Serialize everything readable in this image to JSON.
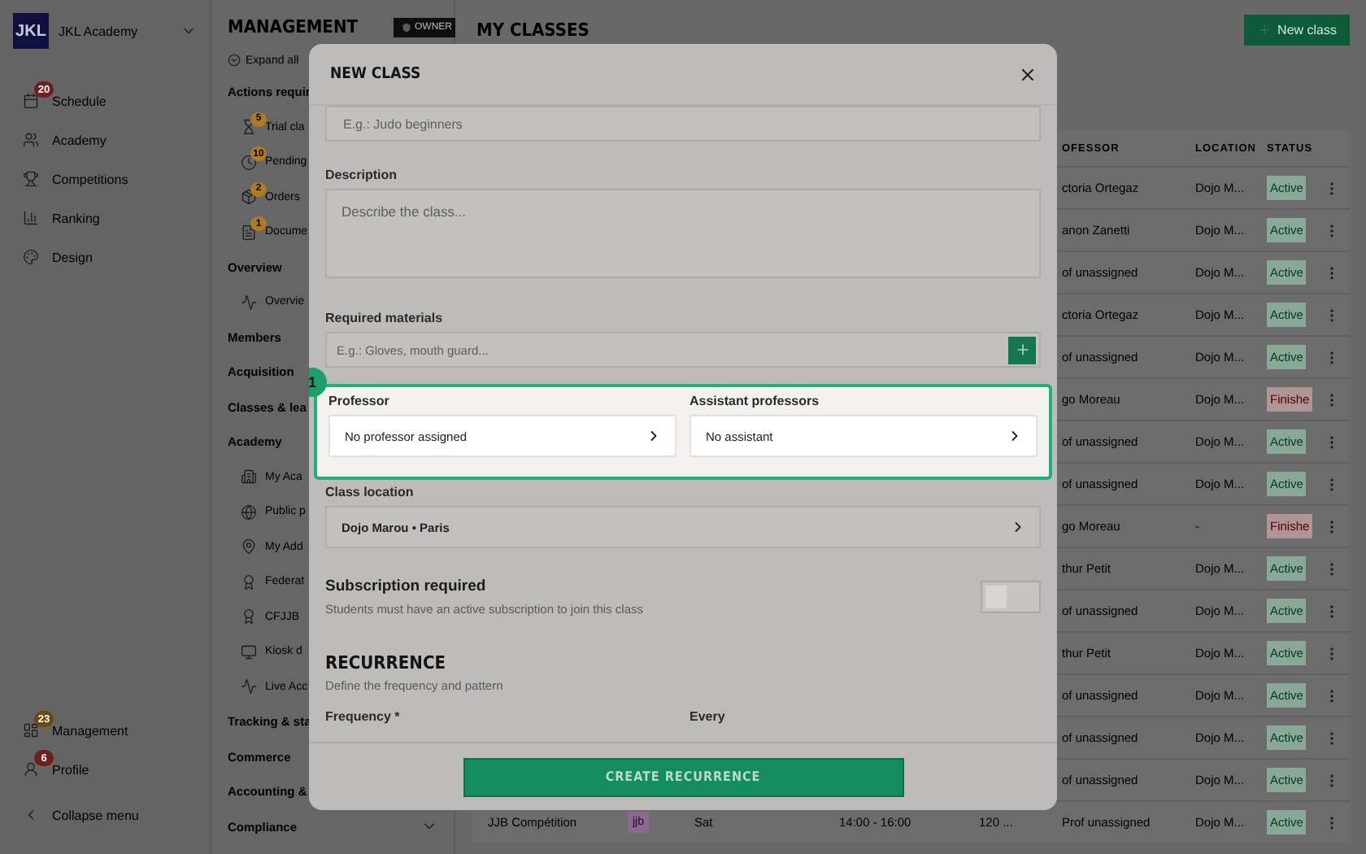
{
  "app": {
    "logo": "JKL",
    "name": "JKL Academy"
  },
  "nav": [
    {
      "label": "Schedule",
      "badge": "20",
      "color": "#6b1f1f"
    },
    {
      "label": "Academy"
    },
    {
      "label": "Competitions"
    },
    {
      "label": "Ranking"
    },
    {
      "label": "Design"
    }
  ],
  "nav_bottom": [
    {
      "label": "Management",
      "badge": "23",
      "color": "#6a4a12"
    },
    {
      "label": "Profile",
      "badge": "6",
      "color": "#6b1f1f"
    }
  ],
  "collapse": "Collapse menu",
  "management": {
    "title": "MANAGEMENT",
    "role": "OWNER",
    "expand": "Expand all",
    "sections": [
      {
        "label": "Actions requir",
        "children": [
          {
            "label": "Trial cla",
            "badge": "5"
          },
          {
            "label": "Pending",
            "badge": "10"
          },
          {
            "label": "Orders",
            "badge": "2"
          },
          {
            "label": "Docume",
            "badge": "1"
          }
        ]
      },
      {
        "label": "Overview",
        "children": [
          {
            "label": "Overvie"
          }
        ]
      },
      {
        "label": "Members"
      },
      {
        "label": "Acquisition"
      },
      {
        "label": "Classes & lea"
      },
      {
        "label": "Academy",
        "children": [
          {
            "label": "My Aca"
          },
          {
            "label": "Public p"
          },
          {
            "label": "My Add"
          },
          {
            "label": "Federat"
          },
          {
            "label": "CFJJB"
          },
          {
            "label": "Kiosk d"
          },
          {
            "label": "Live Acc"
          }
        ]
      },
      {
        "label": "Tracking & sta"
      },
      {
        "label": "Commerce"
      },
      {
        "label": "Accounting &"
      },
      {
        "label": "Compliance",
        "collapsible": true
      }
    ]
  },
  "page": {
    "title": "MY CLASSES",
    "new_button": "New class"
  },
  "table": {
    "columns": [
      "OFESSOR",
      "LOCATION",
      "STATUS"
    ],
    "rows": [
      {
        "professor": "ctoria Ortegaz",
        "location": "Dojo M...",
        "status": "Active",
        "kind": "active"
      },
      {
        "professor": "anon Zanetti",
        "location": "Dojo M...",
        "status": "Active",
        "kind": "active"
      },
      {
        "professor": "of unassigned",
        "location": "Dojo M...",
        "status": "Active",
        "kind": "active"
      },
      {
        "professor": "ctoria Ortegaz",
        "location": "Dojo M...",
        "status": "Active",
        "kind": "active"
      },
      {
        "professor": "of unassigned",
        "location": "Dojo M...",
        "status": "Active",
        "kind": "active"
      },
      {
        "professor": "go Moreau",
        "location": "Dojo M...",
        "status": "Finishe",
        "kind": "finished"
      },
      {
        "professor": "of unassigned",
        "location": "Dojo M...",
        "status": "Active",
        "kind": "active"
      },
      {
        "professor": "of unassigned",
        "location": "Dojo M...",
        "status": "Active",
        "kind": "active"
      },
      {
        "professor": "go Moreau",
        "location": "-",
        "status": "Finishe",
        "kind": "finished"
      },
      {
        "professor": "thur Petit",
        "location": "Dojo M...",
        "status": "Active",
        "kind": "active"
      },
      {
        "professor": "of unassigned",
        "location": "Dojo M...",
        "status": "Active",
        "kind": "active"
      },
      {
        "professor": "thur Petit",
        "location": "Dojo M...",
        "status": "Active",
        "kind": "active"
      },
      {
        "professor": "of unassigned",
        "location": "Dojo M...",
        "status": "Active",
        "kind": "active"
      },
      {
        "professor": "of unassigned",
        "location": "Dojo M...",
        "status": "Active",
        "kind": "active"
      },
      {
        "professor": "of unassigned",
        "location": "Dojo M...",
        "status": "Active",
        "kind": "active"
      },
      {
        "name": "JJB Compétition",
        "tag": "jjb",
        "day": "Sat",
        "time": "14:00 - 16:00",
        "duration": "120 ...",
        "professor": "Prof unassigned",
        "location": "Dojo M...",
        "status": "Active",
        "kind": "active"
      }
    ]
  },
  "dialog": {
    "title": "NEW CLASS",
    "name_field": {
      "placeholder": "E.g.: Judo beginners"
    },
    "description": {
      "label": "Description",
      "placeholder": "Describe the class..."
    },
    "materials": {
      "label": "Required materials",
      "placeholder": "E.g.: Gloves, mouth guard..."
    },
    "staff": {
      "step": "1",
      "highlighted": true,
      "professor": {
        "label": "Professor",
        "value": "No professor assigned"
      },
      "assistants": {
        "label": "Assistant professors",
        "value": "No assistant"
      }
    },
    "location": {
      "label": "Class location",
      "value": "Dojo Marou • Paris"
    },
    "subscription": {
      "title": "Subscription required",
      "text": "Students must have an active subscription to join this class",
      "on": false
    },
    "recurrence": {
      "title": "RECURRENCE",
      "subtitle": "Define the frequency and pattern",
      "frequency_label": "Frequency *",
      "every_label": "Every"
    },
    "submit": "CREATE RECURRENCE"
  }
}
